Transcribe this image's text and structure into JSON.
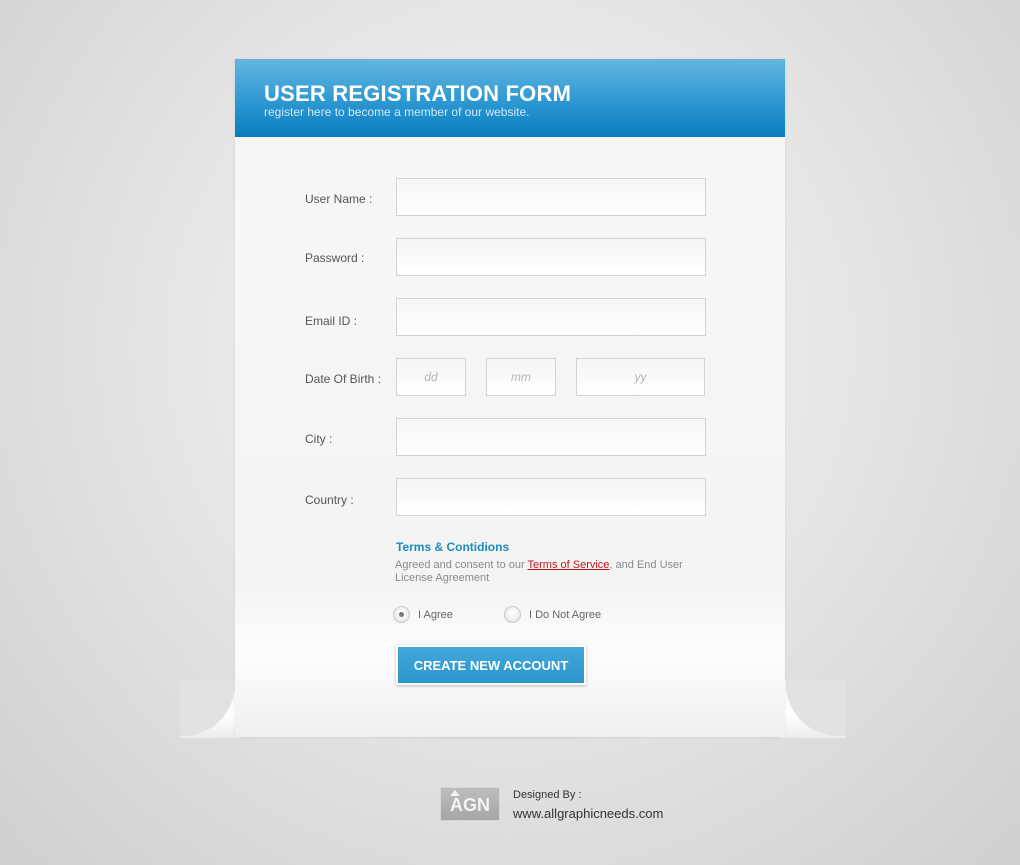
{
  "header": {
    "title": "USER REGISTRATION FORM",
    "subtitle": "register here to become a member of our website."
  },
  "form": {
    "username": {
      "label": "User Name :",
      "value": "",
      "placeholder": ""
    },
    "password": {
      "label": "Password :",
      "value": "",
      "placeholder": ""
    },
    "email": {
      "label": "Email ID :",
      "value": "",
      "placeholder": ""
    },
    "dob": {
      "label": "Date Of Birth :",
      "day_placeholder": "dd",
      "month_placeholder": "mm",
      "year_placeholder": "yy"
    },
    "city": {
      "label": "City :",
      "value": "",
      "placeholder": ""
    },
    "country": {
      "label": "Country :",
      "value": "",
      "placeholder": ""
    }
  },
  "terms": {
    "title": "Terms & Contidions",
    "text_before": "Agreed and consent to our ",
    "link": "Terms of Service",
    "text_after": ", and End User License Agreement",
    "options": [
      {
        "label": "I Agree",
        "selected": true
      },
      {
        "label": "I Do Not Agree",
        "selected": false
      }
    ]
  },
  "submit": {
    "label": "CREATE NEW ACCOUNT"
  },
  "footer": {
    "logo_text": "AGN",
    "designed_by": "Designed By :",
    "website": "www.allgraphicneeds.com"
  },
  "colors": {
    "header_blue": "#2d98d2",
    "terms_title": "#1b8cba",
    "link_red": "#c0161b",
    "button_blue": "#42a8da"
  }
}
